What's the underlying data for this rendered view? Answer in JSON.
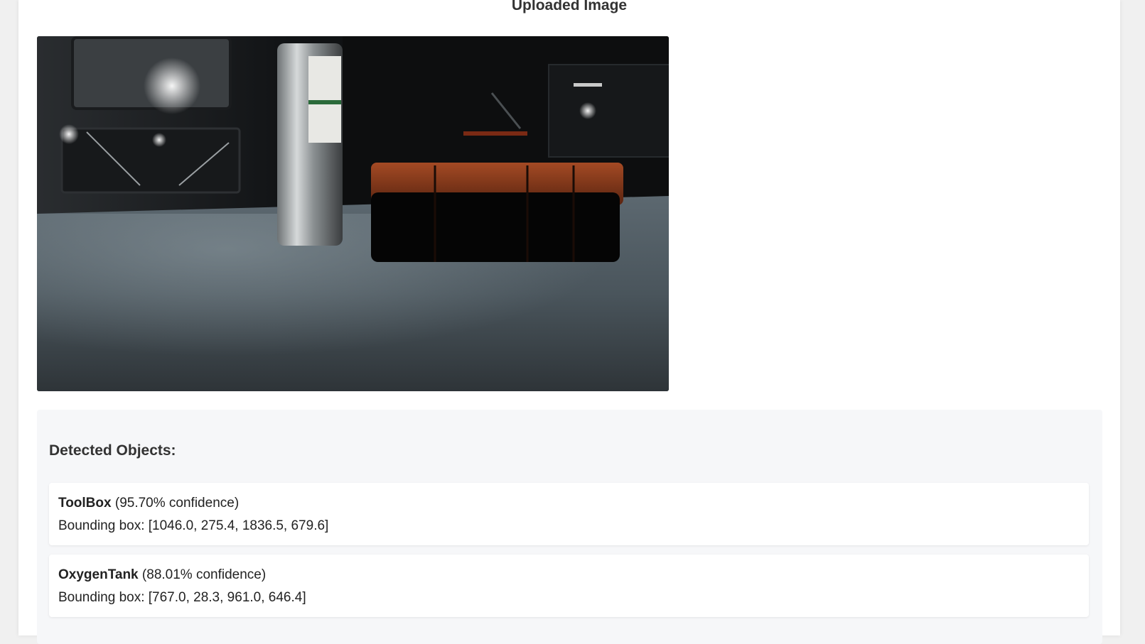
{
  "page": {
    "title": "Uploaded Image"
  },
  "image": {
    "alt": "Space station interior with an oxygen tank and an orange toolbox on a grey floor"
  },
  "detections": {
    "heading": "Detected Objects:",
    "items": [
      {
        "name": "ToolBox",
        "confidence_text": "(95.70% confidence)",
        "bbox_text": "Bounding box: [1046.0, 275.4, 1836.5, 679.6]"
      },
      {
        "name": "OxygenTank",
        "confidence_text": "(88.01% confidence)",
        "bbox_text": "Bounding box: [767.0, 28.3, 961.0, 646.4]"
      }
    ]
  },
  "colors": {
    "page_bg": "#f0f0f0",
    "card_bg": "#ffffff",
    "results_bg": "#f6f7f9",
    "toolbox_orange": "#8a3a1c"
  }
}
